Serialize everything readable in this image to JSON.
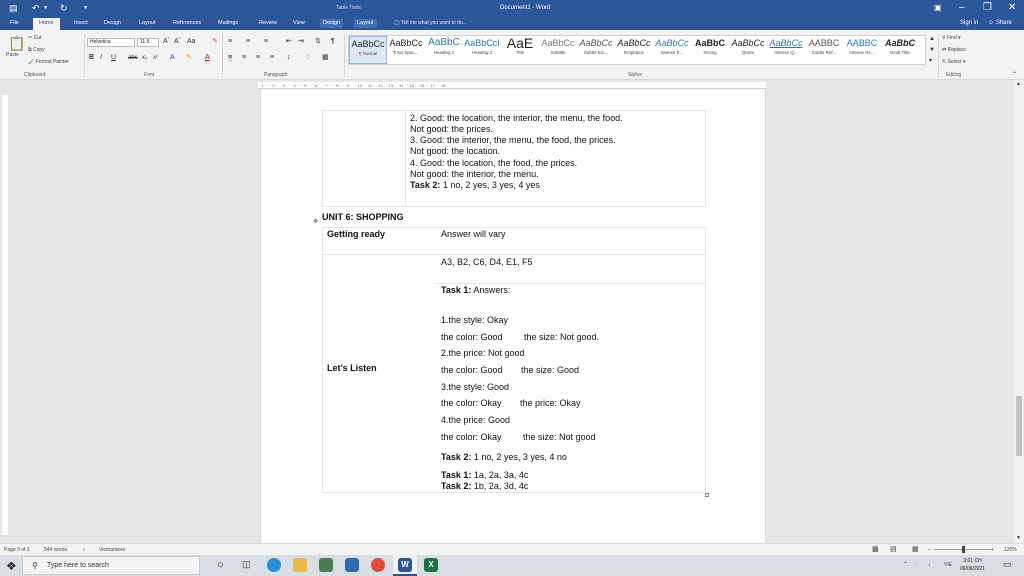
{
  "titlebar": {
    "table_tools": "Table Tools",
    "doc_title": "Document1 - Word"
  },
  "tabs": [
    "File",
    "Home",
    "Insert",
    "Design",
    "Layout",
    "References",
    "Mailings",
    "Review",
    "View",
    "Design",
    "Layout"
  ],
  "tell_me": "Tell me what you want to do...",
  "sign_in": "Sign in",
  "share": "Share",
  "ribbon": {
    "clipboard": {
      "paste": "Paste",
      "cut": "Cut",
      "copy": "Copy",
      "format_painter": "Format Painter",
      "label": "Clipboard"
    },
    "font": {
      "name": "Helvetica",
      "size": "11.5",
      "label": "Font"
    },
    "paragraph": {
      "label": "Paragraph"
    },
    "styles": {
      "label": "Styles",
      "items": [
        {
          "preview": "AaBbCc",
          "name": "¶ Normal"
        },
        {
          "preview": "AaBbCc",
          "name": "¶ No Spac..."
        },
        {
          "preview": "AaBbC",
          "name": "Heading 1"
        },
        {
          "preview": "AaBbCcI",
          "name": "Heading 2"
        },
        {
          "preview": "AaE",
          "name": "Title"
        },
        {
          "preview": "AaBbCc",
          "name": "Subtitle"
        },
        {
          "preview": "AaBbCc",
          "name": "Subtle Em..."
        },
        {
          "preview": "AaBbCc",
          "name": "Emphasis"
        },
        {
          "preview": "AaBbCc",
          "name": "Intense E..."
        },
        {
          "preview": "AaBbC",
          "name": "Strong"
        },
        {
          "preview": "AaBbCc",
          "name": "Quote"
        },
        {
          "preview": "AaBbCc",
          "name": "Intense Q..."
        },
        {
          "preview": "AABBC",
          "name": "Subtle Ref..."
        },
        {
          "preview": "AABBC",
          "name": "Intense Re..."
        },
        {
          "preview": "AaBbC",
          "name": "Book Title"
        }
      ]
    },
    "editing": {
      "find": "Find",
      "replace": "Replace",
      "select": "Select",
      "label": "Editing"
    }
  },
  "document": {
    "prev_cell_lines": [
      {
        "text": "2. Good: the location, the interior, the menu, the food."
      },
      {
        "text": "Not good: the prices."
      },
      {
        "text": "3. Good: the interior, the menu, the food, the prices."
      },
      {
        "text": "Not good: the location."
      },
      {
        "text": "4. Good: the location, the food, the prices."
      },
      {
        "text": "Not good: the interior, the menu."
      },
      {
        "bold": "Task 2:",
        "text": " 1 no, 2 yes, 3 yes, 4 yes"
      }
    ],
    "unit_heading": "UNIT 6: SHOPPING",
    "getting_ready_label": "Getting ready",
    "getting_ready_value": "Answer will vary",
    "lets_listen_label": "Let’s Listen",
    "answer_line": "A3, B2, C6, D4, E1, F5",
    "task1_label": "Task 1:",
    "task1_text": " Answers:",
    "answers": [
      {
        "a": "1.the style: Okay"
      },
      {
        "a": "the color: Good",
        "b": "the size: Not good."
      },
      {
        "a": "2.the price: Not good"
      },
      {
        "a": "the color: Good",
        "b": "the size: Good"
      },
      {
        "a": "3.the style: Good"
      },
      {
        "a": "the color: Okay",
        "b": "the price: Okay"
      },
      {
        "a": "4.the price: Good"
      },
      {
        "a": "the color: Okay",
        "b": "the size: Not good"
      }
    ],
    "task2_label": "Task 2:",
    "task2_text": " 1 no, 2 yes, 3 yes, 4 no",
    "final_task1_label": "Task 1:",
    "final_task1_text": " 1a, 2a, 3a, 4c",
    "final_task2_label": "Task 2:",
    "final_task2_text": " 1b, 2a, 3d, 4c"
  },
  "status": {
    "page": "Page 3 of 3",
    "words": "544 words",
    "language": "Vietnamese",
    "zoom": "120%"
  },
  "taskbar": {
    "search_placeholder": "Type here to search",
    "time": "3:01 CH",
    "date": "06/06/2021",
    "lang": "VIE"
  },
  "colors": {
    "word_blue": "#2b579a"
  }
}
